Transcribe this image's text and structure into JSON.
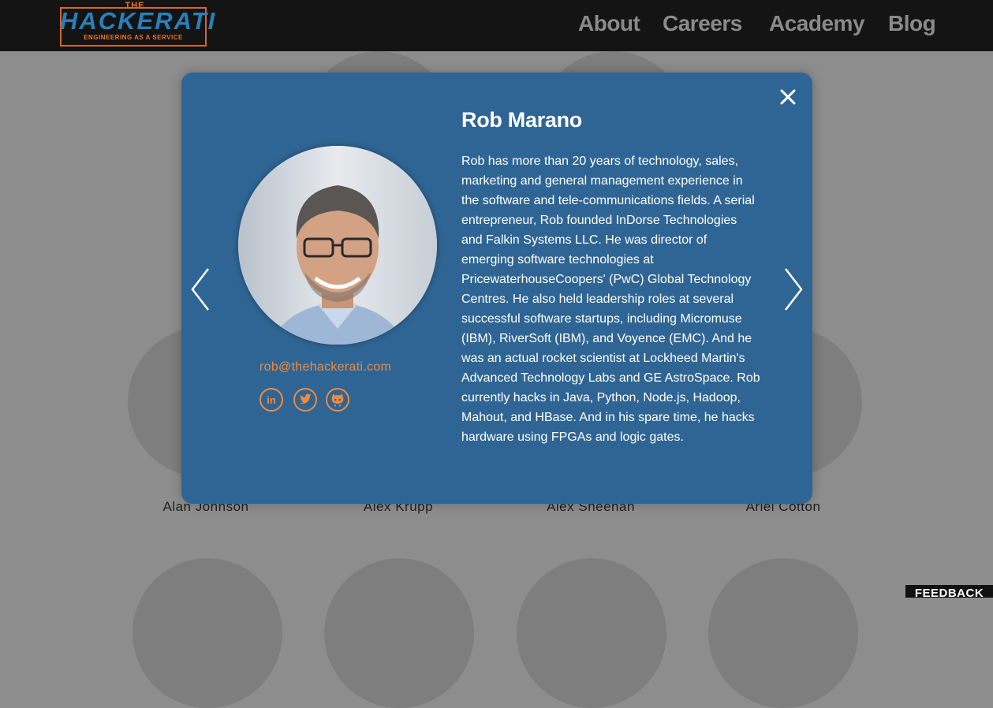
{
  "logo": {
    "top_text": "THE",
    "main_text": "HACKERATI",
    "tagline": "ENGINEERING AS A SERVICE"
  },
  "nav": {
    "items": [
      {
        "label": "About"
      },
      {
        "label": "Careers"
      },
      {
        "label": "Academy"
      },
      {
        "label": "Blog"
      }
    ]
  },
  "team": {
    "names": [
      "Alan Johnson",
      "Alex Krupp",
      "Alex Sheehan",
      "Ariel Cotton"
    ]
  },
  "modal": {
    "name": "Rob Marano",
    "email": "rob@thehackerati.com",
    "bio": "Rob has more than 20 years of technology, sales, marketing and general management experience in the software and tele-communications fields. A serial entrepreneur, Rob founded InDorse Technologies and Falkin Systems LLC. He was director of emerging software technologies at PricewaterhouseCoopers' (PwC) Global Technology Centres. He also held leadership roles at several successful software startups, including Micromuse (IBM), RiverSoft (IBM), and Voyence (EMC). And he was an actual rocket scientist at Lockheed Martin's Advanced Technology Labs and GE AstroSpace. Rob currently hacks in Java, Python, Node.js, Hadoop, Mahout, and HBase. And in his spare time, he hacks hardware using FPGAs and logic gates.",
    "social_icons": [
      "linkedin-icon",
      "twitter-icon",
      "github-icon"
    ]
  },
  "feedback": {
    "label": "FEEDBACK"
  },
  "colors": {
    "navbar_bg": "#141414",
    "modal_bg": "#2f6594",
    "accent_orange": "#ef8a3c",
    "logo_blue": "#2b7fb8",
    "overlay_bg": "#8d8d8d"
  }
}
